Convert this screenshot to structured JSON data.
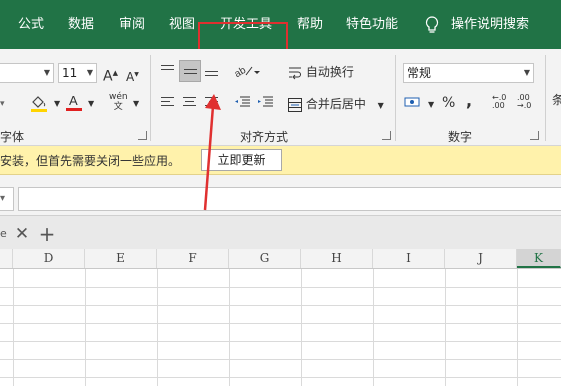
{
  "ribbon_tabs": [
    "公式",
    "数据",
    "审阅",
    "视图",
    "开发工具",
    "帮助",
    "特色功能",
    "操作说明搜索"
  ],
  "highlighted_tab": "开发工具",
  "font": {
    "size": "11",
    "grow_label": "A",
    "shrink_label": "A",
    "phonetic_label": "wén",
    "phonetic_sub": "文"
  },
  "alignment": {
    "wrap_text": "自动换行",
    "merge_center": "合并后居中"
  },
  "number": {
    "format": "常规",
    "percent": "%",
    "comma": ",",
    "inc_decimal": "←.0\n.00",
    "dec_decimal": ".00\n→.0"
  },
  "group_labels": {
    "font": "字体",
    "alignment": "对齐方式",
    "number": "数字"
  },
  "styles_partial_label": "条",
  "message_bar": {
    "text": "安装，但首先需要关闭一些应用。",
    "button": "立即更新"
  },
  "columns": [
    "D",
    "E",
    "F",
    "G",
    "H",
    "I",
    "J",
    "K"
  ],
  "selected_column": "K",
  "colors": {
    "ribbon_green": "#217346",
    "highlight_red": "#e03030",
    "message_yellow": "#fff2ab"
  }
}
